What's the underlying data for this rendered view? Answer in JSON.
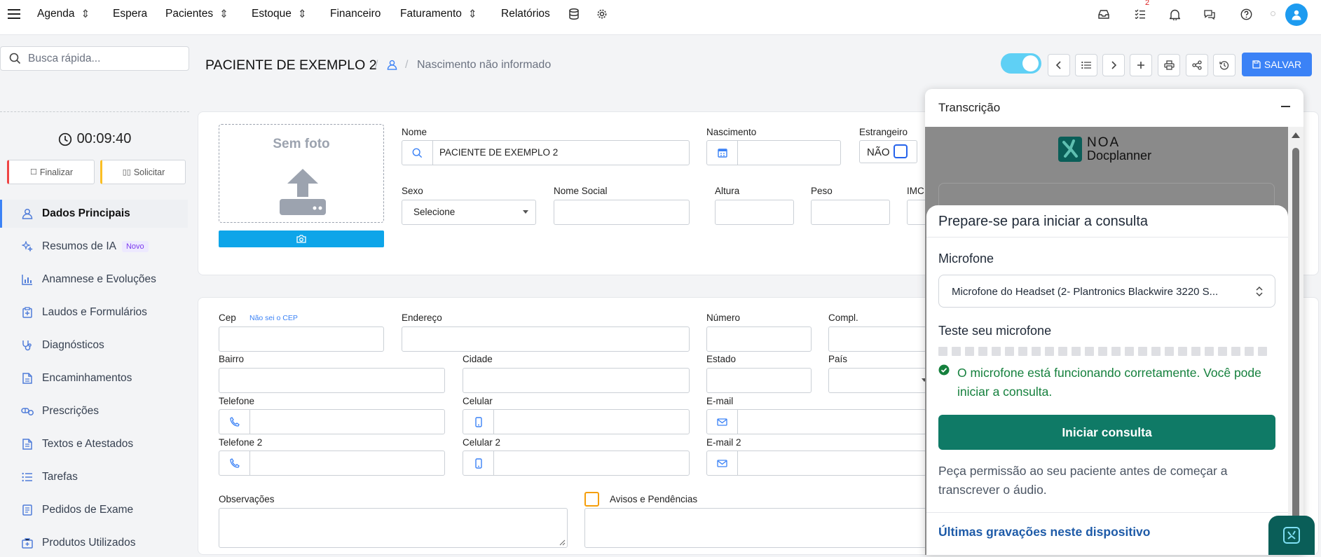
{
  "topnav": {
    "items": [
      "Agenda",
      "Espera",
      "Pacientes",
      "Estoque",
      "Financeiro",
      "Faturamento",
      "Relatórios"
    ],
    "tasks_badge": "2"
  },
  "sidebar": {
    "search_placeholder": "Busca rápida...",
    "timer": "00:09:40",
    "finalizar": "Finalizar",
    "solicitar": "Solicitar",
    "items": [
      {
        "label": "Dados Principais",
        "icon": "user-icon"
      },
      {
        "label": "Resumos de IA",
        "icon": "sparkle-icon",
        "badge": "Novo"
      },
      {
        "label": "Anamnese e Evoluções",
        "icon": "chart-icon"
      },
      {
        "label": "Laudos e Formulários",
        "icon": "clipboard-icon"
      },
      {
        "label": "Diagnósticos",
        "icon": "stethoscope-icon"
      },
      {
        "label": "Encaminhamentos",
        "icon": "document-icon"
      },
      {
        "label": "Prescrições",
        "icon": "pills-icon"
      },
      {
        "label": "Textos e Atestados",
        "icon": "file-text-icon"
      },
      {
        "label": "Tarefas",
        "icon": "list-icon"
      },
      {
        "label": "Pedidos de Exame",
        "icon": "exam-icon"
      },
      {
        "label": "Produtos Utilizados",
        "icon": "product-icon"
      }
    ]
  },
  "header": {
    "patient_name": "PACIENTE DE EXEMPLO 2",
    "separator": "/",
    "birth": "Nascimento não informado",
    "save_label": "SALVAR"
  },
  "form": {
    "sem_foto": "Sem foto",
    "nome_label": "Nome",
    "nome_value": "PACIENTE DE EXEMPLO 2",
    "nascimento_label": "Nascimento",
    "estrangeiro_label": "Estrangeiro",
    "estrangeiro_value": "NÃO",
    "sexo_label": "Sexo",
    "sexo_value": "Selecione",
    "nome_social_label": "Nome Social",
    "altura_label": "Altura",
    "peso_label": "Peso",
    "imc_label": "IMC",
    "cep_label": "Cep",
    "cep_link": "Não sei o CEP",
    "endereco_label": "Endereço",
    "numero_label": "Número",
    "compl_label": "Compl.",
    "bairro_label": "Bairro",
    "cidade_label": "Cidade",
    "estado_label": "Estado",
    "pais_label": "País",
    "telefone_label": "Telefone",
    "celular_label": "Celular",
    "email_label": "E-mail",
    "telefone2_label": "Telefone 2",
    "celular2_label": "Celular 2",
    "email2_label": "E-mail 2",
    "observacoes_label": "Observações",
    "avisos_label": "Avisos e Pendências"
  },
  "transcription": {
    "title": "Transcrição",
    "brand_line1": "NOA",
    "brand_line2": "Docplanner",
    "modal_title": "Prepare-se para iniciar a consulta",
    "mic_label": "Microfone",
    "mic_value": "Microfone do Headset (2- Plantronics Blackwire 3220 S...",
    "test_label": "Teste seu microfone",
    "mic_level": 0,
    "status_text": "O microfone está funcionando corretamente. Você pode iniciar a consulta.",
    "start_button": "Iniciar consulta",
    "permission_text": "Peça permissão ao seu paciente antes de começar a transcrever o áudio.",
    "recordings_label": "Últimas gravações neste dispositivo"
  },
  "colors": {
    "primary": "#3b82f6",
    "upload_bar": "#0ea5e9",
    "start_button": "#0f7a66",
    "success": "#15803d"
  }
}
